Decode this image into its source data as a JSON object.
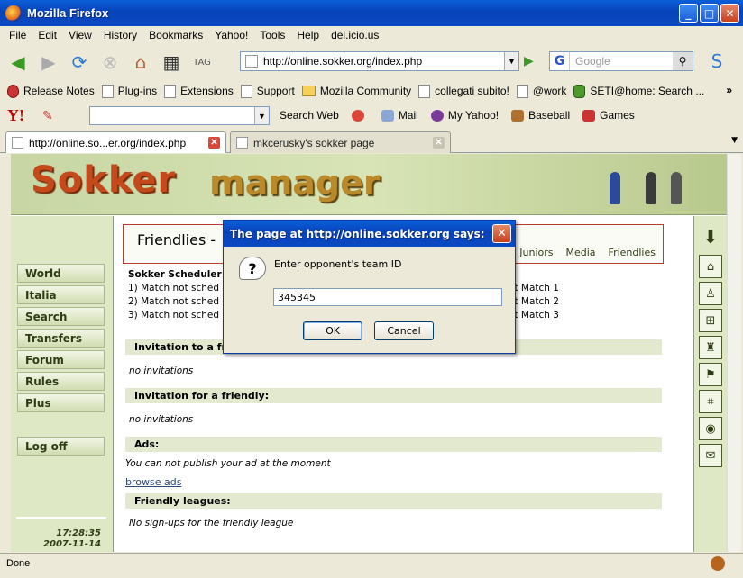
{
  "window": {
    "title": "Mozilla Firefox"
  },
  "menu": [
    "File",
    "Edit",
    "View",
    "History",
    "Bookmarks",
    "Yahoo!",
    "Tools",
    "Help",
    "del.icio.us"
  ],
  "nav": {
    "url": "http://online.sokker.org/index.php",
    "search_placeholder": "Google"
  },
  "bookmarks": [
    "Release Notes",
    "Plug-ins",
    "Extensions",
    "Support",
    "Mozilla Community",
    "collegati subito!",
    "@work",
    "SETI@home: Search ..."
  ],
  "yahoo_toolbar": {
    "search_web": "Search Web",
    "mail": "Mail",
    "my_yahoo": "My Yahoo!",
    "baseball": "Baseball",
    "games": "Games"
  },
  "tabs": [
    {
      "label": "http://online.so...er.org/index.php"
    },
    {
      "label": "mkcerusky's sokker page"
    }
  ],
  "site": {
    "logo_left": "Sokker",
    "logo_right": "manager",
    "left_nav": [
      "World",
      "Italia",
      "Search",
      "Transfers",
      "Forum",
      "Rules",
      "Plus"
    ],
    "logoff": "Log off",
    "time": "17:28:35",
    "date": "2007-11-14",
    "page_title": "Friendlies -",
    "sublinks": [
      "Juniors",
      "Media",
      "Friendlies"
    ],
    "scheduler_heading": "Sokker Scheduler C",
    "scheduler_lines": [
      "1) Match not sched",
      "2) Match not sched",
      "3) Match not sched"
    ],
    "scheduler_right": [
      "et Match 1",
      "et Match 2",
      "et Match 3"
    ],
    "invitation_to": "Invitation to a fri",
    "no_invitations_1": "no invitations",
    "invitation_for": "Invitation for a friendly:",
    "no_invitations_2": "no invitations",
    "ads_heading": "Ads:",
    "ads_text": "You can not publish your ad at the moment",
    "browse_ads": "browse ads",
    "friendly_leagues": "Friendly leagues:",
    "no_signups": "No sign-ups for the friendly league"
  },
  "dialog": {
    "title": "The page at http://online.sokker.org says:",
    "message": "Enter opponent's team ID",
    "input_value": "345345",
    "ok": "OK",
    "cancel": "Cancel"
  },
  "status": {
    "text": "Done"
  }
}
